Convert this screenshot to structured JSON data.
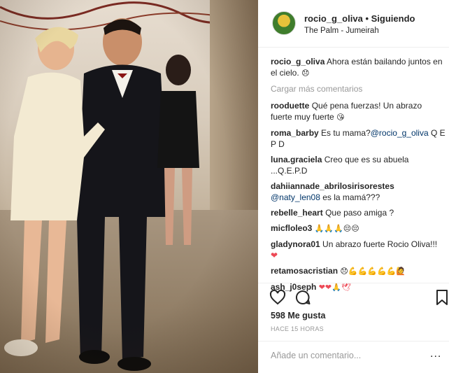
{
  "post": {
    "username": "rocio_g_oliva",
    "separator": "•",
    "follow_state": "Siguiendo",
    "location": "The Palm - Jumeirah",
    "caption_user": "rocio_g_oliva",
    "caption_text": "Ahora están bailando juntos en el cielo.",
    "caption_emoji": "😞",
    "load_more": "Cargar más comentarios",
    "likes": "598 Me gusta",
    "timestamp": "HACE 15 HORAS",
    "comment_placeholder": "Añade un comentario...",
    "more_options": "..."
  },
  "comments": [
    {
      "user": "rooduette",
      "text": "Qué pena fuerzas! Un abrazo fuerte muy fuerte",
      "emoji": "😘"
    },
    {
      "user": "roma_barby",
      "text": "Es tu mama?",
      "mention": "@rocio_g_oliva",
      "text2": " Q E P D"
    },
    {
      "user": "luna.graciela",
      "text": "Creo que es su abuela ...Q.E.P.D"
    },
    {
      "user": "dahiiannade_abrilosirisorestes",
      "mention": "@naty_len08",
      "text2": " es la mamá???"
    },
    {
      "user": "rebelle_heart",
      "text": "Que paso amiga ?"
    },
    {
      "user": "micfloleo3",
      "emoji": "🙏🙏🙏😔😔"
    },
    {
      "user": "gladynora01",
      "text": "Un abrazo fuerte Rocio Oliva!!!",
      "emoji": "❤"
    },
    {
      "user": "retamosacristian",
      "emoji": "😞💪💪💪💪💪🙋"
    },
    {
      "user": "ash_j0seph",
      "emoji": "❤❤🙏🕊"
    }
  ],
  "icons": {
    "like": "heart-outline-icon",
    "comment": "speech-bubble-icon",
    "save": "bookmark-icon"
  },
  "colors": {
    "link": "#003569",
    "muted": "#999999",
    "heart": "#ed4956"
  }
}
